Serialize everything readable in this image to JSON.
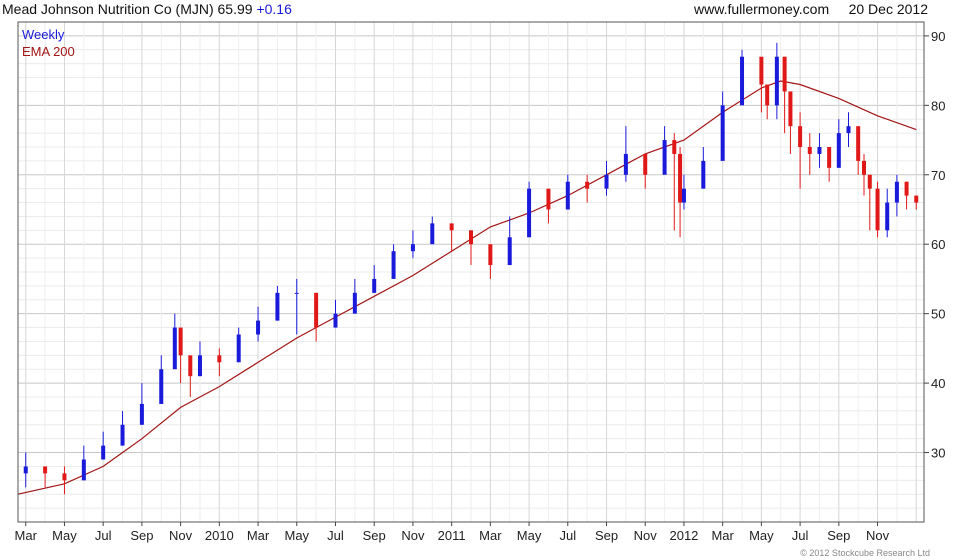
{
  "header": {
    "title": "Mead Johnson Nutrition Co (MJN) 65.99",
    "change": "+0.16",
    "site": "www.fullermoney.com",
    "date": "20 Dec 2012"
  },
  "legend": {
    "weekly": "Weekly",
    "ema": "EMA 200"
  },
  "copyright": "© 2012 Stockcube Research Ltd",
  "colors": {
    "up": "#1a1adb",
    "down": "#e01818",
    "ema": "#a31515",
    "grid": "#d6d6d6"
  },
  "chart_data": {
    "type": "candlestick",
    "title": "Mead Johnson Nutrition Co (MJN) 65.99 +0.16",
    "ylim": [
      20,
      92
    ],
    "y_ticks": [
      30,
      40,
      50,
      60,
      70,
      80,
      90
    ],
    "x_labels": [
      "Mar",
      "May",
      "Jul",
      "Sep",
      "Nov",
      "2010",
      "Mar",
      "May",
      "Jul",
      "Sep",
      "Nov",
      "2011",
      "Mar",
      "May",
      "Jul",
      "Sep",
      "Nov",
      "2012",
      "Mar",
      "May",
      "Jul",
      "Sep",
      "Nov"
    ],
    "x_label_months": [
      2,
      4,
      6,
      8,
      10,
      12,
      14,
      16,
      18,
      20,
      22,
      24,
      26,
      28,
      30,
      32,
      34,
      36,
      38,
      40,
      42,
      44,
      46
    ],
    "x_start_month": 1.6,
    "x_end_month": 48.4,
    "grid": true,
    "legend": "top-left",
    "series": [
      {
        "name": "Weekly",
        "style": "candlestick",
        "months": [
          2,
          3,
          4,
          5,
          6,
          7,
          8,
          9,
          9.7,
          10,
          10.5,
          11,
          12,
          13,
          14,
          15,
          16,
          17,
          18,
          19,
          20,
          21,
          22,
          23,
          24,
          25,
          26,
          27,
          28,
          29,
          30,
          31,
          32,
          33,
          34,
          35,
          35.5,
          35.8,
          36,
          37,
          38,
          39,
          40,
          40.3,
          40.8,
          41.2,
          41.5,
          42,
          42.5,
          43,
          43.5,
          44,
          44.5,
          45,
          45.3,
          45.6,
          46,
          46.5,
          47,
          47.5,
          48
        ],
        "close": [
          28,
          27,
          26,
          29,
          31,
          34,
          37,
          42,
          48,
          44,
          41,
          44,
          43,
          47,
          49,
          53,
          53,
          48,
          50,
          53,
          55,
          59,
          60,
          63,
          62,
          60,
          57,
          61,
          68,
          65,
          69,
          68,
          70,
          73,
          70,
          75,
          73,
          66,
          68,
          72,
          80,
          87,
          83,
          80,
          87,
          82,
          77,
          74,
          73,
          74,
          71,
          76,
          77,
          72,
          70,
          68,
          62,
          66,
          69,
          67,
          66
        ],
        "high": [
          30,
          28,
          28,
          31,
          33,
          36,
          40,
          44,
          50,
          46,
          43,
          46,
          45,
          48,
          51,
          54,
          55,
          50,
          52,
          55,
          57,
          60,
          62,
          64,
          63,
          62,
          58,
          64,
          69,
          66,
          70,
          70,
          72,
          77,
          73,
          77,
          76,
          74,
          70,
          74,
          82,
          88,
          85,
          83,
          89,
          87,
          81,
          79,
          76,
          76,
          74,
          78,
          79,
          76,
          73,
          70,
          69,
          68,
          70,
          69,
          67
        ],
        "low": [
          25,
          25,
          24,
          26,
          29,
          31,
          34,
          38,
          43,
          40,
          38,
          41,
          41,
          44,
          46,
          49,
          47,
          46,
          48,
          51,
          53,
          56,
          58,
          61,
          59,
          57,
          55,
          59,
          64,
          63,
          65,
          66,
          67,
          69,
          68,
          71,
          62,
          61,
          65,
          70,
          76,
          82,
          79,
          78,
          78,
          76,
          73,
          68,
          70,
          71,
          69,
          73,
          74,
          70,
          67,
          62,
          61,
          61,
          64,
          65,
          65
        ]
      },
      {
        "name": "EMA 200",
        "style": "line",
        "months": [
          1.6,
          4,
          6,
          8,
          10,
          12,
          14,
          16,
          18,
          20,
          22,
          24,
          26,
          28,
          30,
          32,
          34,
          36,
          38,
          40,
          41,
          42,
          44,
          46,
          48
        ],
        "values": [
          24,
          25.5,
          28,
          32,
          36.5,
          39.5,
          43,
          46.5,
          49.5,
          52.5,
          55.5,
          59,
          62.5,
          64.5,
          67,
          70,
          73,
          75,
          79,
          82.5,
          83.5,
          83,
          81,
          78.5,
          76.5
        ]
      }
    ]
  }
}
